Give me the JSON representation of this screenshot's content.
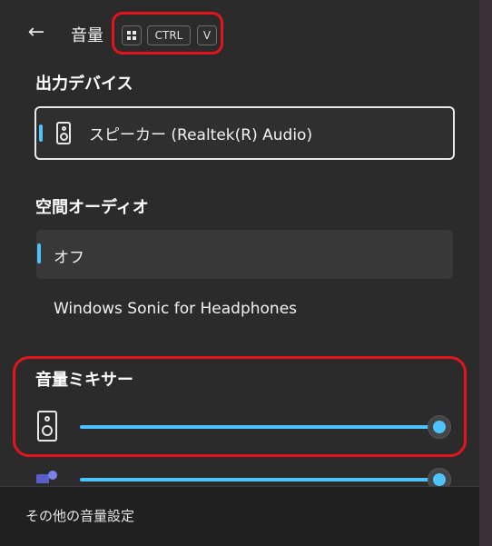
{
  "header": {
    "back_icon": "back-arrow-icon",
    "title": "音量",
    "shortcut_keys": {
      "win_icon": "windows-logo-icon",
      "ctrl": "CTRL",
      "v": "V"
    }
  },
  "output": {
    "heading": "出力デバイス",
    "device_icon": "speaker-icon",
    "device_label": "スピーカー (Realtek(R) Audio)"
  },
  "spatial": {
    "heading": "空間オーディオ",
    "options": [
      "オフ",
      "Windows Sonic for Headphones"
    ],
    "selected": "オフ"
  },
  "mixer": {
    "heading": "音量ミキサー",
    "rows": [
      {
        "icon": "speaker-icon",
        "level": 1.0
      },
      {
        "icon": "teams-icon",
        "level": 1.0
      }
    ]
  },
  "footer": {
    "link": "その他の音量設定"
  },
  "colors": {
    "accent": "#4cc2ff",
    "highlight": "#e5141c",
    "panel": "#2b2b2b"
  }
}
